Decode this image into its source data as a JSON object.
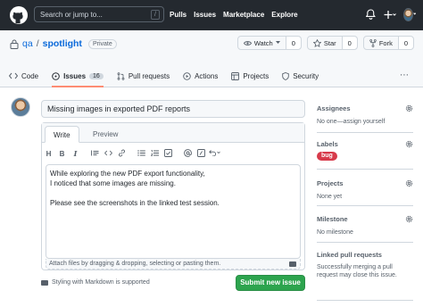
{
  "header": {
    "search_placeholder": "Search or jump to...",
    "slash_key": "/",
    "nav": [
      "Pulls",
      "Issues",
      "Marketplace",
      "Explore"
    ],
    "icons": [
      "github-logo-icon",
      "bell-icon",
      "plus-icon",
      "chevron-down-icon",
      "avatar"
    ]
  },
  "repo": {
    "owner": "qa",
    "separator": "/",
    "name": "spotlight",
    "visibility": "Private",
    "watch_label": "Watch",
    "watch_count": "0",
    "star_label": "Star",
    "star_count": "0",
    "fork_label": "Fork",
    "fork_count": "0",
    "tabs": [
      {
        "label": "Code",
        "icon": "code-icon"
      },
      {
        "label": "Issues",
        "icon": "issue-icon",
        "count": "16"
      },
      {
        "label": "Pull requests",
        "icon": "pull-request-icon"
      },
      {
        "label": "Actions",
        "icon": "play-icon"
      },
      {
        "label": "Projects",
        "icon": "table-icon"
      },
      {
        "label": "Security",
        "icon": "shield-icon"
      }
    ],
    "more": "⋯"
  },
  "issue": {
    "title": "Missing images in exported PDF reports",
    "write_tab": "Write",
    "preview_tab": "Preview",
    "body_lines": [
      "While exploring the new PDF export functionality,",
      "I noticed that some images are missing.",
      "",
      "Please see the screenshots in the linked test session."
    ],
    "attach_hint": "Attach files by dragging & dropping, selecting or pasting them.",
    "markdown_note": "Styling with Markdown is supported",
    "submit_label": "Submit new issue"
  },
  "sidebar": {
    "assignees": {
      "title": "Assignees",
      "value": "No one—assign yourself"
    },
    "labels": {
      "title": "Labels",
      "value": "bug"
    },
    "projects": {
      "title": "Projects",
      "value": "None yet"
    },
    "milestone": {
      "title": "Milestone",
      "value": "No milestone"
    },
    "linked_prs": {
      "title": "Linked pull requests",
      "value": "Successfully merging a pull request may close this issue."
    },
    "label_color": "#d73a4a"
  },
  "colors": {
    "header_bg": "#24292f",
    "submit_green": "#2da44e",
    "link_blue": "#0969da",
    "active_tab_underline": "#fd8c73"
  }
}
